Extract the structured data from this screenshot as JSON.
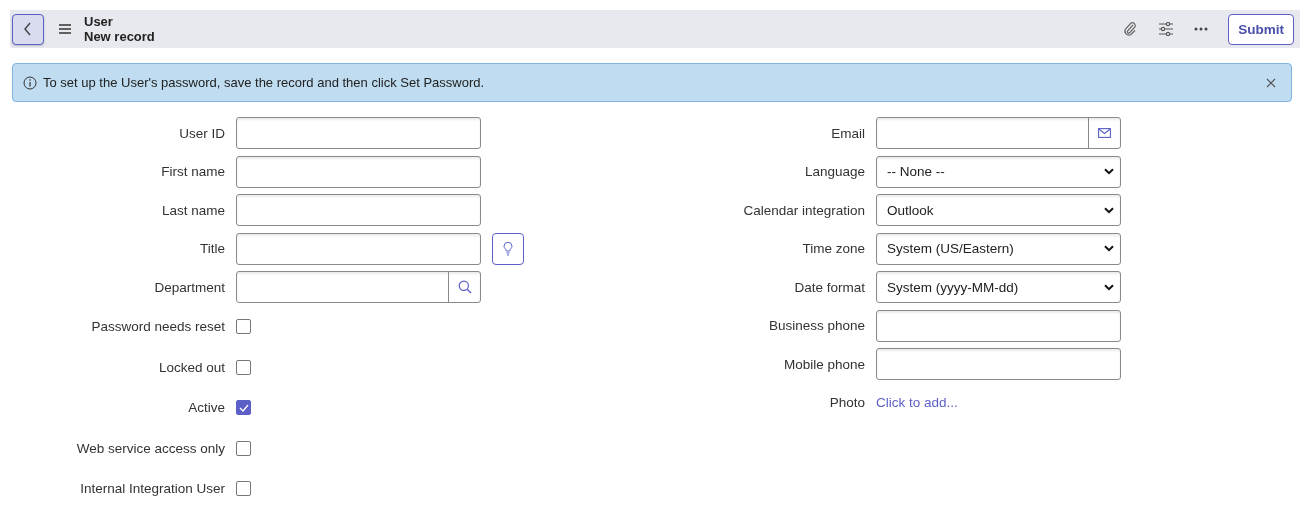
{
  "header": {
    "table": "User",
    "record": "New record",
    "submit": "Submit"
  },
  "banner": {
    "message": "To set up the User's password, save the record and then click Set Password."
  },
  "left_fields": [
    {
      "label": "User ID",
      "kind": "text"
    },
    {
      "label": "First name",
      "kind": "text"
    },
    {
      "label": "Last name",
      "kind": "text"
    },
    {
      "label": "Title",
      "kind": "suggest"
    },
    {
      "label": "Department",
      "kind": "lookup"
    },
    {
      "label": "Password needs reset",
      "kind": "checkbox",
      "checked": false
    },
    {
      "label": "Locked out",
      "kind": "checkbox",
      "checked": false
    },
    {
      "label": "Active",
      "kind": "checkbox",
      "checked": true
    },
    {
      "label": "Web service access only",
      "kind": "checkbox",
      "checked": false
    },
    {
      "label": "Internal Integration User",
      "kind": "checkbox",
      "checked": false
    }
  ],
  "right_fields": [
    {
      "label": "Email",
      "kind": "email"
    },
    {
      "label": "Language",
      "kind": "select",
      "value": "-- None --"
    },
    {
      "label": "Calendar integration",
      "kind": "select",
      "value": "Outlook"
    },
    {
      "label": "Time zone",
      "kind": "select",
      "value": "System (US/Eastern)"
    },
    {
      "label": "Date format",
      "kind": "select",
      "value": "System (yyyy-MM-dd)"
    },
    {
      "label": "Business phone",
      "kind": "text"
    },
    {
      "label": "Mobile phone",
      "kind": "text"
    },
    {
      "label": "Photo",
      "kind": "link",
      "value": "Click to add..."
    }
  ]
}
